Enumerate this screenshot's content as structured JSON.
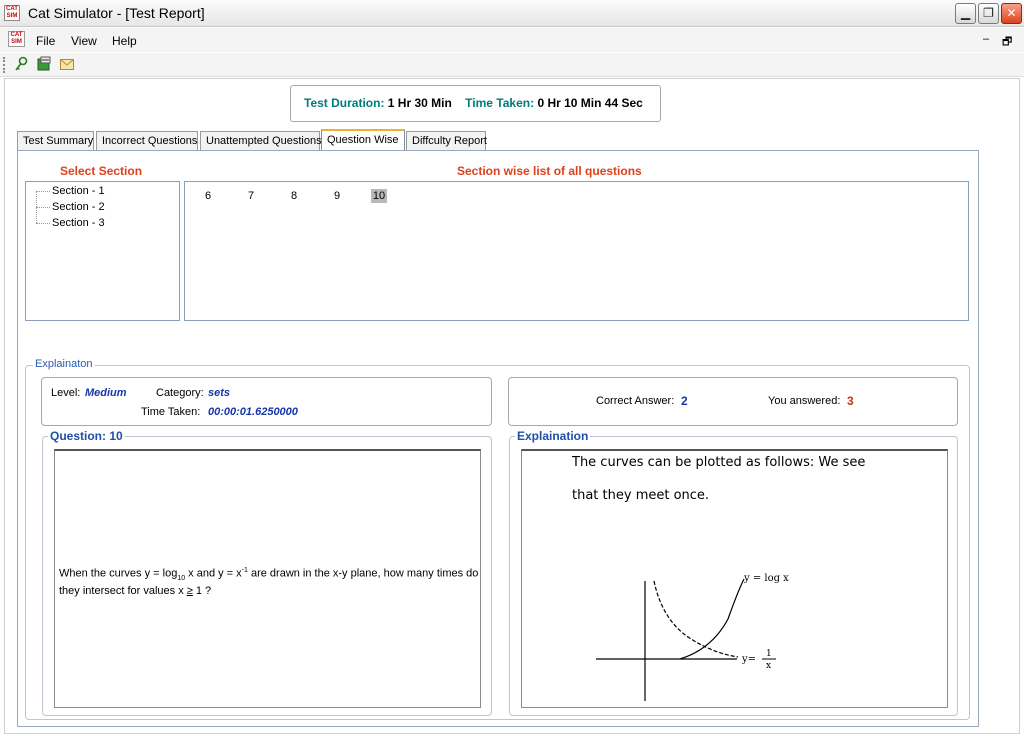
{
  "window": {
    "title": "Cat Simulator - [Test Report]",
    "icon_text": "CAT SIM",
    "controls": [
      "minimize-icon",
      "restore-icon",
      "close-icon"
    ]
  },
  "menu": {
    "items": [
      "File",
      "View",
      "Help"
    ],
    "mdi_minimize": "–",
    "mdi_restore": "🗗"
  },
  "toolbar": {
    "icons": [
      "key-icon",
      "summary-icon",
      "email-icon"
    ]
  },
  "test_info": {
    "duration_label": "Test Duration:",
    "duration_value": "1 Hr 30 Min",
    "taken_label": "Time Taken:",
    "taken_value": "0 Hr 10 Min 44 Sec"
  },
  "tabs": [
    {
      "label": "Test Summary",
      "active": false
    },
    {
      "label": "Incorrect Questions",
      "active": false
    },
    {
      "label": "Unattempted Questions",
      "active": false
    },
    {
      "label": "Question Wise",
      "active": true
    },
    {
      "label": "Diffculty Report",
      "active": false
    }
  ],
  "section_select": {
    "title": "Select Section",
    "sections": [
      "Section - 1",
      "Section - 2",
      "Section - 3"
    ]
  },
  "question_list": {
    "title": "Section wise list of all questions",
    "numbers": [
      "6",
      "7",
      "8",
      "9",
      "10"
    ],
    "selected": "10"
  },
  "explanation_group": {
    "legend": "Explainaton",
    "level_label": "Level:",
    "level_value": "Medium",
    "category_label": "Category:",
    "category_value": "sets",
    "time_label": "Time Taken:",
    "time_value": "00:00:01.6250000",
    "correct_label": "Correct Answer:",
    "correct_value": "2",
    "answered_label": "You answered:",
    "answered_value": "3"
  },
  "question_panel": {
    "legend": "Question: 10",
    "text_part1": "When the curves y = log",
    "text_sub": "10",
    "text_part2": " x and y = x",
    "text_sup": "-1",
    "text_part3": " are drawn in the x-y plane, how many times do they intersect for values x ",
    "text_ge": "≥",
    "text_part4": " 1 ?"
  },
  "explanation_panel": {
    "legend": "Explaination",
    "line1": "The curves can be plotted as follows: We see",
    "line2": "that they meet once.",
    "graph_label_log": "y = log x",
    "graph_label_recip_y": "y=",
    "graph_label_recip_num": "1",
    "graph_label_recip_den": "x"
  }
}
